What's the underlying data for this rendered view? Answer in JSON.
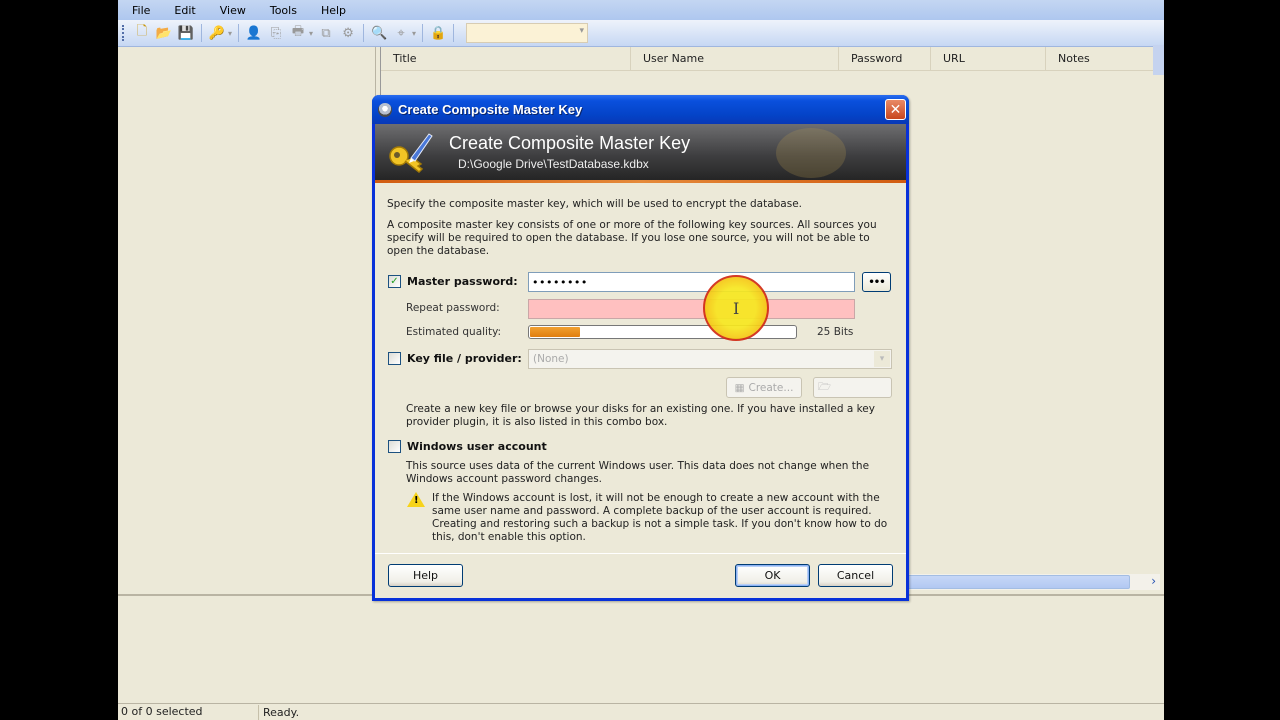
{
  "app": {
    "menu": [
      "File",
      "Edit",
      "View",
      "Tools",
      "Help"
    ],
    "toolbar_icons": [
      "new-database-icon",
      "open-database-icon",
      "save-icon",
      "add-entry-icon",
      "copy-username-icon",
      "copy-password-icon",
      "print-icon",
      "lock-icon",
      "find-icon",
      "quick-find-dropdown"
    ],
    "columns": [
      "Title",
      "User Name",
      "Password",
      "URL",
      "Notes"
    ],
    "status": {
      "selection": "0 of 0 selected",
      "state": "Ready."
    }
  },
  "dialog": {
    "window_title": "Create Composite Master Key",
    "banner_title": "Create Composite Master Key",
    "banner_path": "D:\\Google Drive\\TestDatabase.kdbx",
    "intro": "Specify the composite master key, which will be used to encrypt the database.",
    "description": "A composite master key consists of one or more of the following key sources. All sources you specify will be required to open the database.  If you lose one source, you will not be able to open the database.",
    "master_password": {
      "label": "Master password:",
      "checked": true,
      "value": "••••••••",
      "toggle_label": "•••"
    },
    "repeat_password": {
      "label": "Repeat password:",
      "value": ""
    },
    "quality": {
      "label": "Estimated quality:",
      "fraction": 0.19,
      "bits_label": "25 Bits"
    },
    "key_file": {
      "label": "Key file / provider:",
      "checked": false,
      "selected": "(None)",
      "create_label": "Create...",
      "browse_label": "",
      "help_text": "Create a new key file or browse your disks for an existing one. If you have installed a key provider plugin, it is also listed in this combo box."
    },
    "windows_account": {
      "label": "Windows user account",
      "checked": false,
      "help_text": "This source uses data of the current Windows user. This data does not change when the Windows account password changes.",
      "warning": "If the Windows account is lost, it will not be enough to create a new account with the same user name and password. A complete backup of the user account is required. Creating and restoring such a backup is not a simple task. If you don't know how to do this, don't enable this option."
    },
    "buttons": {
      "help": "Help",
      "ok": "OK",
      "cancel": "Cancel"
    }
  }
}
